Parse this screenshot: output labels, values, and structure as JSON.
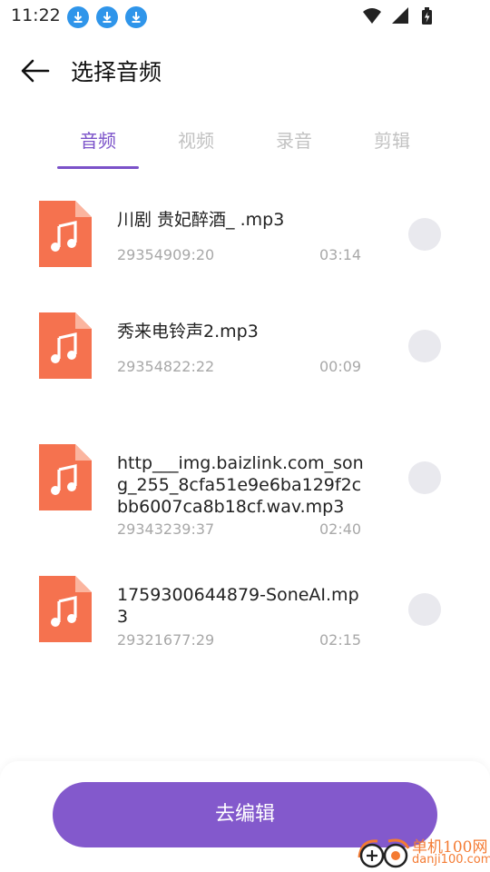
{
  "status_bar": {
    "time": "11:22",
    "download_icons": [
      "download-icon",
      "download-icon",
      "download-icon"
    ],
    "icons": [
      "wifi-icon",
      "signal-icon",
      "battery-charging-icon"
    ]
  },
  "header": {
    "back_icon": "arrow-left-icon",
    "title": "选择音频"
  },
  "tabs": [
    {
      "label": "音频",
      "active": true
    },
    {
      "label": "视频",
      "active": false
    },
    {
      "label": "录音",
      "active": false
    },
    {
      "label": "剪辑",
      "active": false
    }
  ],
  "files": [
    {
      "name": "川剧 贵妃醉酒_ .mp3",
      "size": "29354909:20",
      "duration": "03:14",
      "selected": false
    },
    {
      "name": "秀来电铃声2.mp3",
      "size": "29354822:22",
      "duration": "00:09",
      "selected": false
    },
    {
      "name": "http___img.baizlink.com_song_255_8cfa51e9e6ba129f2cbb6007ca8b18cf.wav.mp3",
      "size": "29343239:37",
      "duration": "02:40",
      "selected": false
    },
    {
      "name": "1759300644879-SoneAI.mp3",
      "size": "29321677:29",
      "duration": "02:15",
      "selected": false
    }
  ],
  "file_icon": "music-file-icon",
  "bottom": {
    "button_label": "去编辑"
  },
  "watermark": {
    "main": "单机100网",
    "sub": "danji100.com"
  },
  "colors": {
    "accent": "#7b52c9",
    "button": "#8359cc",
    "file_icon": "#f5724f",
    "radio": "#e9e9ee"
  }
}
